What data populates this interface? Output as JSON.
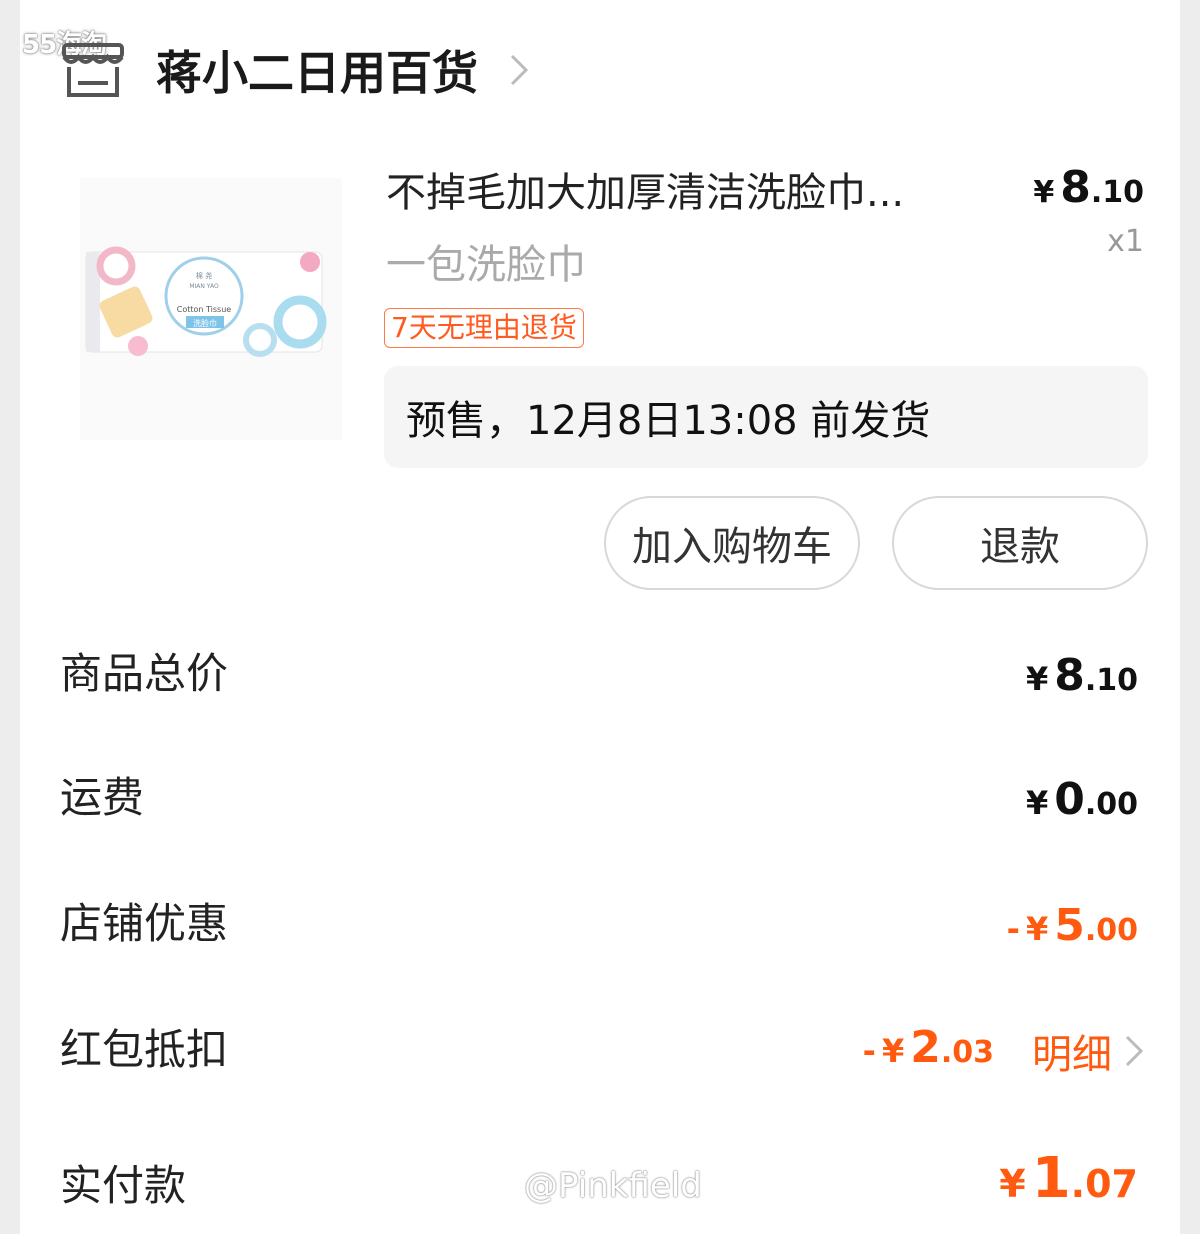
{
  "watermark_top": "55海淘",
  "watermark_bottom": "@Pinkfield",
  "shop": {
    "name": "蒋小二日用百货",
    "icon": "store-icon"
  },
  "product": {
    "title": "不掉毛加大加厚清洁洗脸巾...",
    "variant": "一包洗脸巾",
    "price_symbol": "¥",
    "price_int": "8",
    "price_dec": ".10",
    "quantity": "x1",
    "return_badge": "7天无理由退货",
    "presale_text": "预售，12月8日13:08 前发货",
    "package_text": {
      "brand_cn": "棉 尧",
      "brand_en": "MIAN YAO",
      "line1": "Cotton Tissue",
      "line2": "洗脸巾"
    }
  },
  "actions": {
    "add_to_cart": "加入购物车",
    "refund": "退款"
  },
  "summary": [
    {
      "label": "商品总价",
      "sign": "",
      "symbol": "¥",
      "int": "8",
      "dec": ".10",
      "color": "#111111"
    },
    {
      "label": "运费",
      "sign": "",
      "symbol": "¥",
      "int": "0",
      "dec": ".00",
      "color": "#111111"
    },
    {
      "label": "店铺优惠",
      "sign": "-",
      "symbol": "¥",
      "int": "5",
      "dec": ".00",
      "color": "#ff5a0f"
    },
    {
      "label": "红包抵扣",
      "sign": "-",
      "symbol": "¥",
      "int": "2",
      "dec": ".03",
      "color": "#ff5a0f"
    },
    {
      "label": "实付款",
      "sign": "",
      "symbol": "¥",
      "int": "1",
      "dec": ".07",
      "color": "#ff5a0f"
    }
  ],
  "detail_link": "明细",
  "colors": {
    "accent": "#ff5a0f",
    "badge_border": "#ff7a45",
    "panel": "#f5f5f5"
  }
}
